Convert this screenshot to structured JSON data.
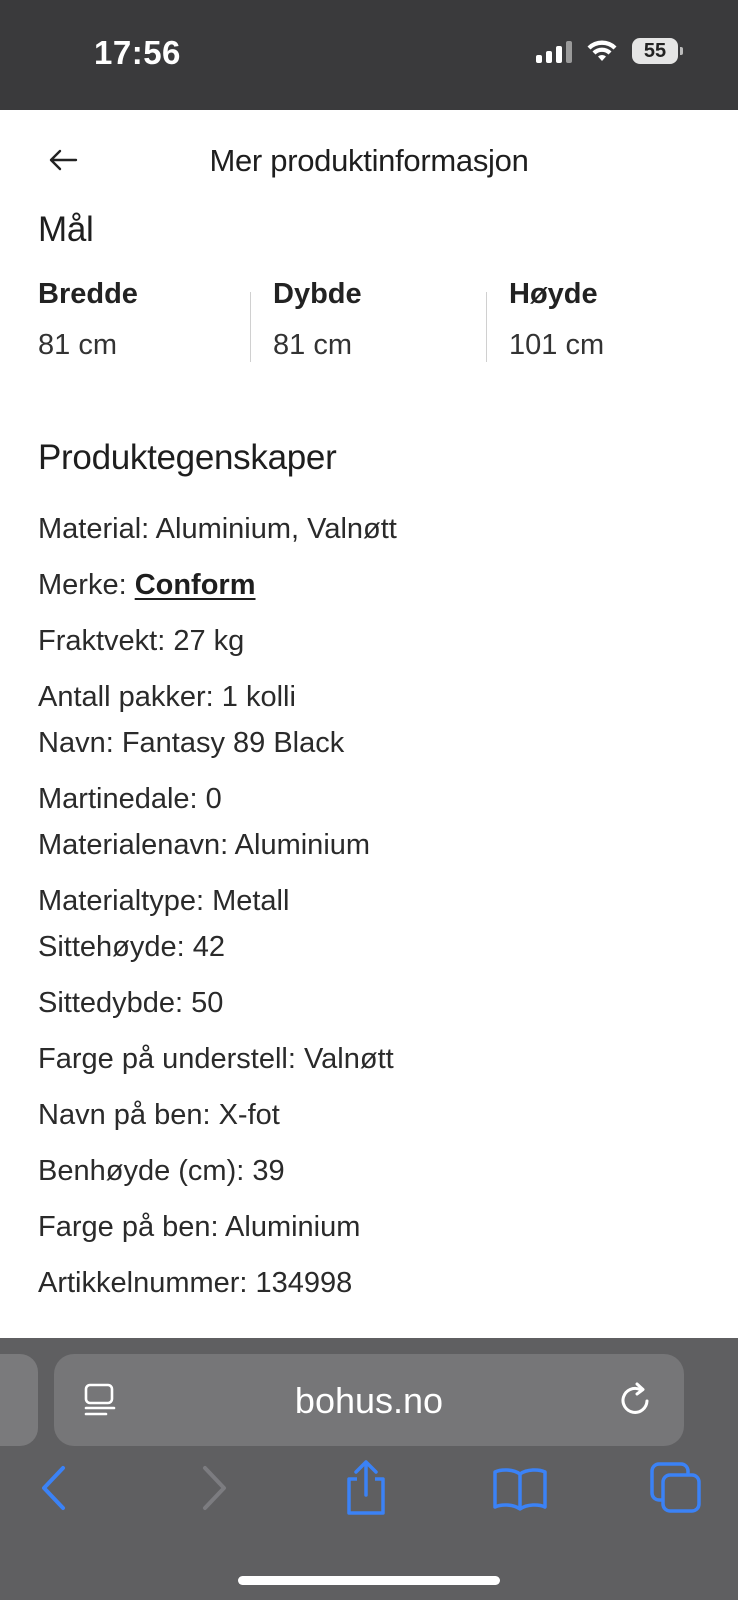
{
  "status_bar": {
    "time": "17:56",
    "battery": "55",
    "icons": [
      "signal-icon",
      "wifi-icon",
      "battery-icon"
    ]
  },
  "header": {
    "title": "Mer produktinformasjon",
    "back_icon": "arrow-left-icon"
  },
  "dimensions": {
    "title": "Mål",
    "items": [
      {
        "label": "Bredde",
        "value": "81 cm"
      },
      {
        "label": "Dybde",
        "value": "81 cm"
      },
      {
        "label": "Høyde",
        "value": "101 cm"
      }
    ]
  },
  "properties": {
    "title": "Produktegenskaper",
    "items": [
      "Material: Aluminium, Valnøtt",
      "Merke: ",
      "Fraktvekt: 27 kg",
      "Antall pakker: 1 kolli",
      "Navn: Fantasy 89 Black",
      "Martinedale: 0",
      "Materialenavn: Aluminium",
      "Materialtype: Metall",
      "Sittehøyde: 42",
      "Sittedybde: 50",
      "Farge på understell: Valnøtt",
      "Navn på ben: X-fot",
      "Benhøyde (cm): 39",
      "Farge på ben: Aluminium",
      "Artikkelnummer: 134998"
    ],
    "brand_link": "Conform"
  },
  "browser": {
    "address": "bohus.no",
    "icons": [
      "reader-icon",
      "reload-icon",
      "back-icon",
      "forward-icon",
      "share-icon",
      "bookmarks-icon",
      "tabs-icon"
    ],
    "accent_color": "#3b82f6"
  }
}
